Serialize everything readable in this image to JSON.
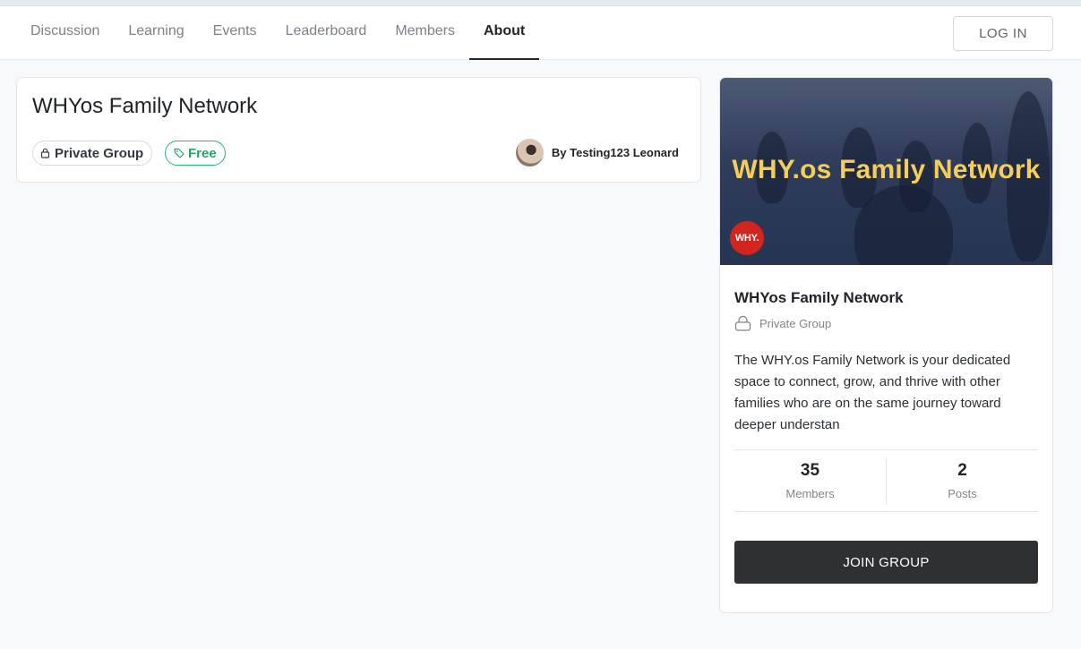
{
  "nav": {
    "tabs": [
      {
        "label": "Discussion"
      },
      {
        "label": "Learning"
      },
      {
        "label": "Events"
      },
      {
        "label": "Leaderboard"
      },
      {
        "label": "Members"
      },
      {
        "label": "About"
      }
    ],
    "active_tab": "About",
    "login_label": "LOG IN"
  },
  "group": {
    "title": "WHYos Family Network",
    "privacy_badge": "Private Group",
    "price_badge": "Free",
    "author": "By Testing123 Leonard"
  },
  "sidebar": {
    "banner_title": "WHY.os Family Network",
    "banner_logo_text": "WHY.",
    "title": "WHYos Family Network",
    "privacy": "Private Group",
    "description": "The WHY.os Family Network is your dedicated space to connect, grow, and thrive with other families who are on the same journey toward deeper understan",
    "stats": [
      {
        "value": "35",
        "label": "Members"
      },
      {
        "value": "2",
        "label": "Posts"
      }
    ],
    "join_label": "JOIN GROUP"
  },
  "colors": {
    "free_badge": "#1ea866",
    "join_button": "#2f3033",
    "banner_title": "#f5cd5a",
    "logo": "#d4241e"
  },
  "icons": {
    "privacy": "lock-icon",
    "price": "tag-icon"
  }
}
